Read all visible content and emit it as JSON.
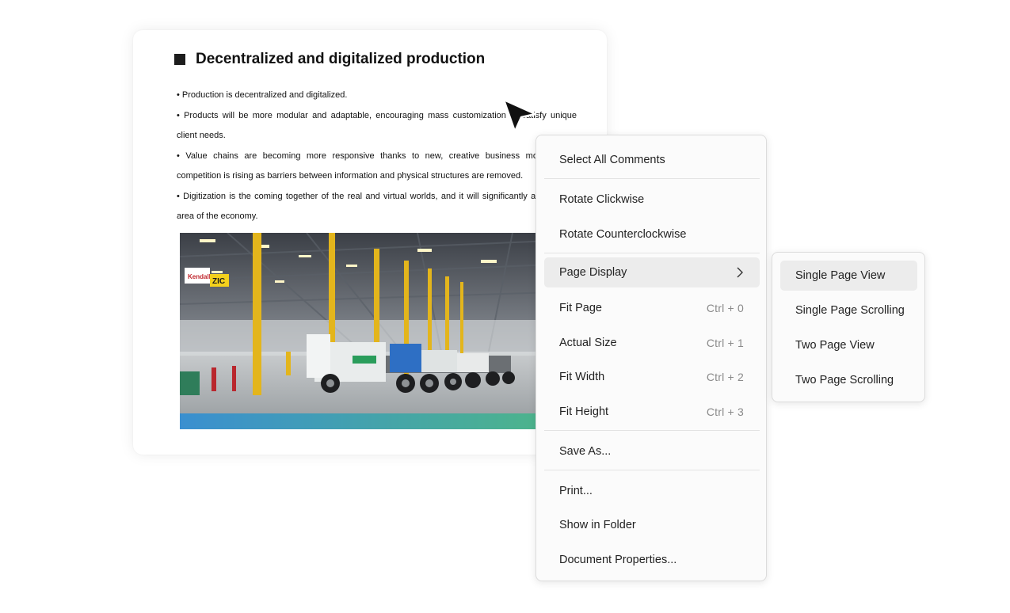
{
  "document": {
    "title": "Decentralized and digitalized production",
    "bullets": [
      "•  Production is decentralized and digitalized.",
      "• Products will be more modular and adaptable, encouraging mass customization to satisfy unique client needs.",
      "• Value chains are becoming more responsive thanks to new, creative business models, and competition is rising as barriers between information and physical structures are removed.",
      "• Digitization is the coming together of the real and virtual worlds, and it will significantly affect every area of the economy."
    ],
    "photo_signs": [
      "Kendall",
      "ZIC"
    ]
  },
  "context_menu": {
    "select_all_comments": "Select All Comments",
    "rotate_clockwise": "Rotate Clickwise",
    "rotate_counterclockwise": "Rotate Counterclockwise",
    "page_display": "Page Display",
    "fit_page": {
      "label": "Fit Page",
      "shortcut": "Ctrl + 0"
    },
    "actual_size": {
      "label": "Actual Size",
      "shortcut": "Ctrl + 1"
    },
    "fit_width": {
      "label": "Fit Width",
      "shortcut": "Ctrl + 2"
    },
    "fit_height": {
      "label": "Fit Height",
      "shortcut": "Ctrl + 3"
    },
    "save_as": "Save As...",
    "print": "Print...",
    "show_in_folder": "Show in Folder",
    "document_properties": "Document Properties..."
  },
  "page_display_submenu": {
    "single_page_view": "Single Page View",
    "single_page_scrolling": "Single Page Scrolling",
    "two_page_view": "Two Page View",
    "two_page_scrolling": "Two Page Scrolling"
  },
  "colors": {
    "menu_background": "#fbfbfb",
    "menu_hover": "#ececec",
    "shortcut_text": "#8a8a8a",
    "photo_pillars": "#e3b51c",
    "truck_cab": "#2e6fc4",
    "floor_stripe": "#3aa0c8"
  },
  "icons": [
    "cursor-arrow-icon",
    "chevron-right-icon",
    "title-square-icon"
  ]
}
